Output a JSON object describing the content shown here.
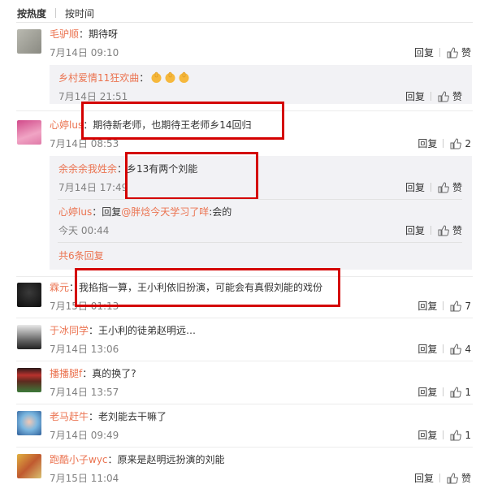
{
  "sort": {
    "hot": "按热度",
    "time": "按时间"
  },
  "actions": {
    "reply": "回复",
    "like": "赞"
  },
  "comments": [
    {
      "user": "毛驴顺",
      "text": "期待呀",
      "time": "7月14日 09:10",
      "likes": "赞"
    },
    {
      "user": "心婷lus",
      "text": "期待新老师，也期待王老师乡14回归",
      "time": "7月14日 08:53",
      "likes": "2"
    },
    {
      "user": "霖元",
      "text": "我掐指一算，王小利依旧扮演，可能会有真假刘能的戏份",
      "time": "7月15日 01:13",
      "likes": "7"
    },
    {
      "user": "于冰同学",
      "text": "王小利的徒弟赵明远…",
      "time": "7月14日 13:06",
      "likes": "4"
    },
    {
      "user": "播播腿f",
      "text": "真的换了?",
      "time": "7月14日 13:57",
      "likes": "1"
    },
    {
      "user": "老马赶牛",
      "text": "老刘能去干嘛了",
      "time": "7月14日 09:49",
      "likes": "1"
    },
    {
      "user": "跑酷小子wyc",
      "text": "原来是赵明远扮演的刘能",
      "time": "7月15日 11:04",
      "likes": "赞"
    }
  ],
  "replies": [
    {
      "user": "乡村爱情11狂欢曲",
      "text": "",
      "time": "7月14日 21:51",
      "likes": "赞"
    },
    {
      "user": "余余余我姓余",
      "text": "乡13有两个刘能",
      "time": "7月14日 17:49",
      "likes": "赞"
    },
    {
      "user": "心婷lus",
      "prefix": "回复",
      "mention": "@胖焓今天学习了咩",
      "text": ":会的",
      "time": "今天 00:44",
      "likes": "赞"
    }
  ],
  "more_replies": "共6条回复",
  "colors": {
    "username": "#eb7350",
    "highlight_box": "#d40000",
    "reply_bg": "#f2f2f5"
  }
}
